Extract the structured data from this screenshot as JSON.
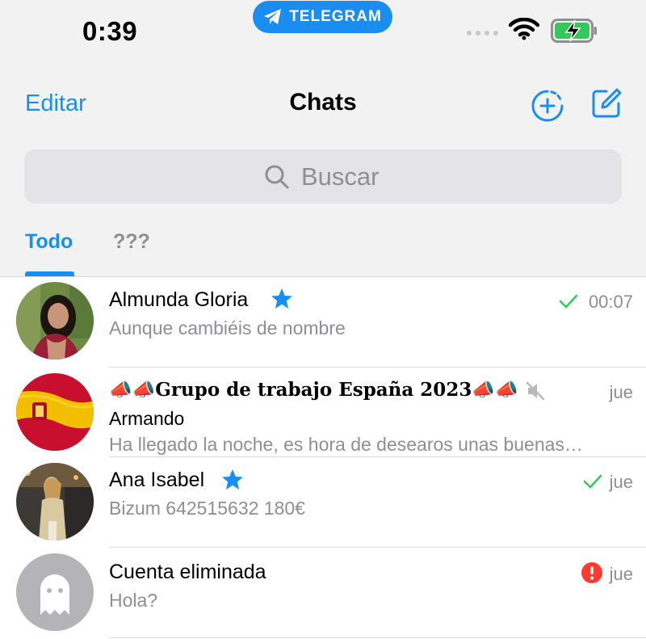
{
  "status_bar": {
    "time": "0:39",
    "app_pill": "TELEGRAM"
  },
  "nav": {
    "edit_label": "Editar",
    "title": "Chats"
  },
  "search": {
    "placeholder": "Buscar"
  },
  "tabs": [
    {
      "label": "Todo",
      "active": true
    },
    {
      "label": "???",
      "active": false
    }
  ],
  "chats": [
    {
      "name": "Almunda Gloria",
      "starred": true,
      "message": "Aunque cambiéis de nombre",
      "time": "00:07",
      "status": "read-check"
    },
    {
      "name": "📣📣Grupo de trabajo España 2023📣📣",
      "muted": true,
      "sender": "Armando",
      "message": "Ha llegado la noche, es hora de desearos unas buenas…",
      "time": "jue"
    },
    {
      "name": "Ana Isabel",
      "starred": true,
      "message": "Bizum 642515632 180€",
      "time": "jue",
      "status": "read-check"
    },
    {
      "name": "Cuenta eliminada",
      "message": "Hola?",
      "time": "jue",
      "status": "error"
    }
  ],
  "colors": {
    "accent": "#1a8ef0",
    "check": "#34c759",
    "error": "#ff3b30",
    "secondary_text": "#8e8e93"
  }
}
